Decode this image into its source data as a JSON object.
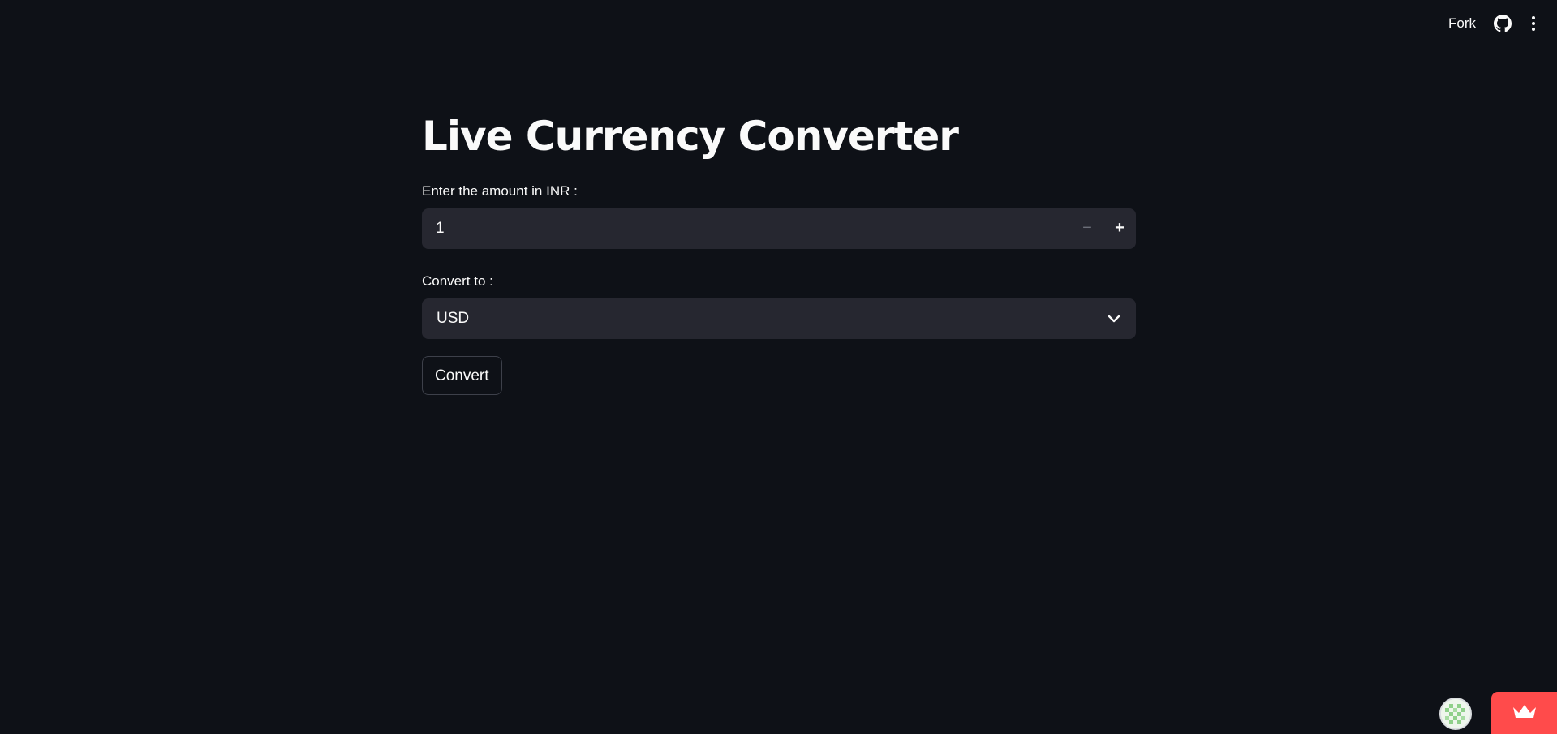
{
  "header": {
    "fork_label": "Fork",
    "icons": [
      "github-icon",
      "more-vertical-icon"
    ]
  },
  "main": {
    "title": "Live Currency Converter",
    "amount_label": "Enter the amount in INR :",
    "amount_value": "1",
    "decrement_symbol": "−",
    "increment_symbol": "+",
    "currency_label": "Convert to :",
    "currency_selected": "USD",
    "convert_label": "Convert"
  },
  "footer": {
    "avatar_icon": "user-avatar-icon",
    "badge_icon": "crown-icon",
    "badge_color": "#ff4b4b"
  },
  "theme": {
    "background": "#0e1117",
    "input_background": "#262730",
    "text": "#fafafa"
  }
}
